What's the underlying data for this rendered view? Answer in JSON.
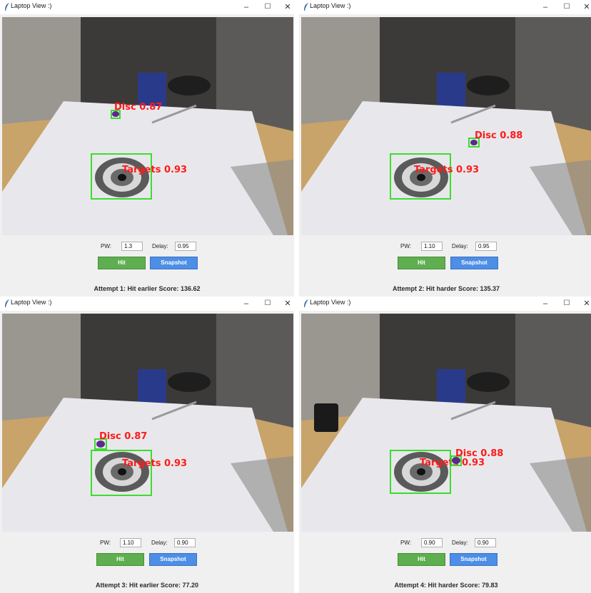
{
  "windows": [
    {
      "title": "Laptop View :)",
      "pw_label": "PW:",
      "pw_value": "1.3",
      "delay_label": "Delay:",
      "delay_value": "0.95",
      "hit_label": "Hit",
      "snapshot_label": "Snapshot",
      "status": "Attempt 1: Hit earlier   Score: 136.62",
      "disc_label": "Disc 0.87",
      "target_label": "Targets 0.93"
    },
    {
      "title": "Laptop View :)",
      "pw_label": "PW:",
      "pw_value": "1.10",
      "delay_label": "Delay:",
      "delay_value": "0.95",
      "hit_label": "Hit",
      "snapshot_label": "Snapshot",
      "status": "Attempt 2: Hit harder   Score: 135.37",
      "disc_label": "Disc 0.88",
      "target_label": "Targets 0.93"
    },
    {
      "title": "Laptop View :)",
      "pw_label": "PW:",
      "pw_value": "1.10",
      "delay_label": "Delay:",
      "delay_value": "0.90",
      "hit_label": "Hit",
      "snapshot_label": "Snapshot",
      "status": "Attempt 3: Hit earlier   Score: 77.20",
      "disc_label": "Disc 0.87",
      "target_label": "Targets 0.93"
    },
    {
      "title": "Laptop View :)",
      "pw_label": "PW:",
      "pw_value": "0.90",
      "delay_label": "Delay:",
      "delay_value": "0.90",
      "hit_label": "Hit",
      "snapshot_label": "Snapshot",
      "status": "Attempt 4: Hit harder   Score: 79.83",
      "disc_label": "Disc 0.88",
      "target_label": "Targets 0.93"
    }
  ],
  "icons": {
    "app": "feather-icon",
    "minimize": "minimize-icon",
    "maximize": "maximize-icon",
    "close": "close-icon"
  },
  "colors": {
    "detection_box": "#3ddc2f",
    "detection_text": "#ff1a1a",
    "hit_button": "#5fae4f",
    "snapshot_button": "#4d8ee6",
    "disc": "#5a2a8a"
  }
}
